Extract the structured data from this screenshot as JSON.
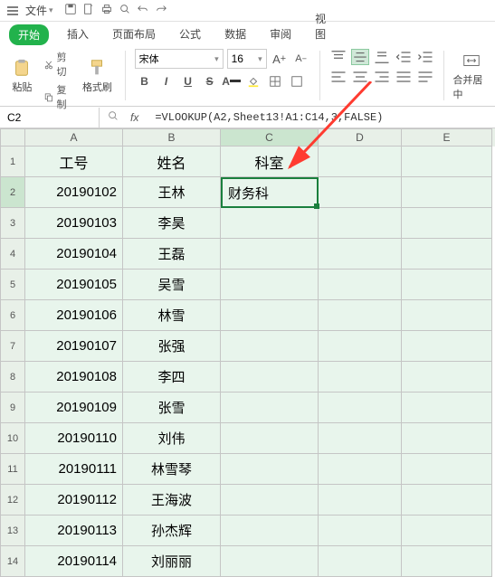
{
  "menubar": {
    "file_label": "文件"
  },
  "tabs": {
    "items": [
      "开始",
      "插入",
      "页面布局",
      "公式",
      "数据",
      "审阅",
      "视图"
    ],
    "active_index": 0
  },
  "ribbon": {
    "paste": "粘贴",
    "cut": "剪切",
    "copy": "复制",
    "format_painter": "格式刷",
    "font_name": "宋体",
    "font_size": "16",
    "merge": "合并居中"
  },
  "namebox": "C2",
  "formula": "=VLOOKUP(A2,Sheet13!A1:C14,3,FALSE)",
  "columns": [
    "A",
    "B",
    "C",
    "D",
    "E"
  ],
  "selected_col": "C",
  "selected_row": 2,
  "grid": {
    "headers": {
      "A": "工号",
      "B": "姓名",
      "C": "科室"
    },
    "rows": [
      {
        "n": 1,
        "A": "工号",
        "B": "姓名",
        "C": "科室"
      },
      {
        "n": 2,
        "A": "20190102",
        "B": "王林",
        "C": "财务科"
      },
      {
        "n": 3,
        "A": "20190103",
        "B": "李昊",
        "C": ""
      },
      {
        "n": 4,
        "A": "20190104",
        "B": "王磊",
        "C": ""
      },
      {
        "n": 5,
        "A": "20190105",
        "B": "吴雪",
        "C": ""
      },
      {
        "n": 6,
        "A": "20190106",
        "B": "林雪",
        "C": ""
      },
      {
        "n": 7,
        "A": "20190107",
        "B": "张强",
        "C": ""
      },
      {
        "n": 8,
        "A": "20190108",
        "B": "李四",
        "C": ""
      },
      {
        "n": 9,
        "A": "20190109",
        "B": "张雪",
        "C": ""
      },
      {
        "n": 10,
        "A": "20190110",
        "B": "刘伟",
        "C": ""
      },
      {
        "n": 11,
        "A": "20190111",
        "B": "林雪琴",
        "C": ""
      },
      {
        "n": 12,
        "A": "20190112",
        "B": "王海波",
        "C": ""
      },
      {
        "n": 13,
        "A": "20190113",
        "B": "孙杰辉",
        "C": ""
      },
      {
        "n": 14,
        "A": "20190114",
        "B": "刘丽丽",
        "C": ""
      }
    ]
  },
  "colors": {
    "accent": "#22b24c",
    "selection": "#1a7f3d",
    "arrow": "#ff3b30"
  }
}
